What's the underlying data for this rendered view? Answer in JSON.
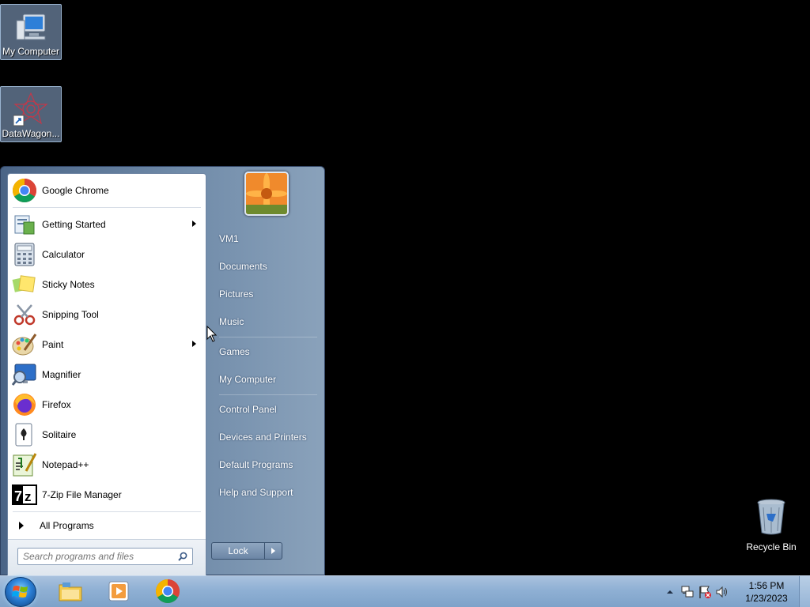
{
  "desktop": {
    "icons": [
      {
        "label": "My Computer",
        "icon": "computer-icon"
      },
      {
        "label": "DataWagon...",
        "icon": "datawagon-icon"
      }
    ],
    "recycle_bin": {
      "label": "Recycle Bin",
      "icon": "recycle-bin-icon"
    }
  },
  "start_menu": {
    "pinned": [
      {
        "label": "Google Chrome",
        "icon": "chrome-icon",
        "submenu": false
      }
    ],
    "recent": [
      {
        "label": "Getting Started",
        "icon": "getting-started-icon",
        "submenu": true
      },
      {
        "label": "Calculator",
        "icon": "calculator-icon",
        "submenu": false
      },
      {
        "label": "Sticky Notes",
        "icon": "sticky-notes-icon",
        "submenu": false
      },
      {
        "label": "Snipping Tool",
        "icon": "scissors-icon",
        "submenu": false
      },
      {
        "label": "Paint",
        "icon": "paint-icon",
        "submenu": true
      },
      {
        "label": "Magnifier",
        "icon": "magnifier-icon",
        "submenu": false
      },
      {
        "label": "Firefox",
        "icon": "firefox-icon",
        "submenu": false
      },
      {
        "label": "Solitaire",
        "icon": "solitaire-icon",
        "submenu": false
      },
      {
        "label": "Notepad++",
        "icon": "notepadpp-icon",
        "submenu": false
      },
      {
        "label": "7-Zip File Manager",
        "icon": "7zip-icon",
        "submenu": false
      }
    ],
    "all_programs_label": "All Programs",
    "search_placeholder": "Search programs and files",
    "right_links_group1": [
      "VM1",
      "Documents",
      "Pictures",
      "Music"
    ],
    "right_links_group2": [
      "Games",
      "My Computer"
    ],
    "right_links_group3": [
      "Control Panel",
      "Devices and Printers",
      "Default Programs",
      "Help and Support"
    ],
    "lock_label": "Lock"
  },
  "taskbar": {
    "pinned": [
      {
        "name": "explorer",
        "icon": "folder-icon"
      },
      {
        "name": "media-player",
        "icon": "media-player-icon"
      },
      {
        "name": "chrome",
        "icon": "chrome-icon"
      }
    ],
    "clock": {
      "time": "1:56 PM",
      "date": "1/23/2023"
    }
  },
  "colors": {
    "taskbar": "#8fb0d4",
    "start_menu_right": "#6f8aa8",
    "accent": "#2b7fd6"
  }
}
